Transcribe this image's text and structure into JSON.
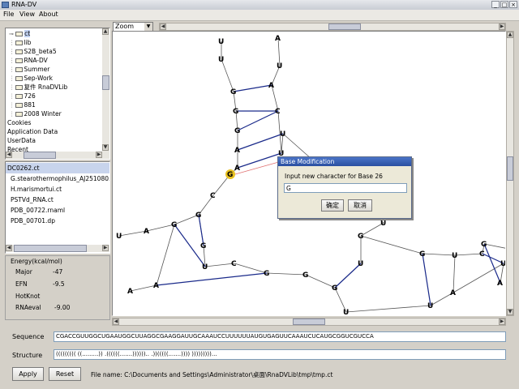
{
  "window": {
    "title": "RNA-DV",
    "minimize": "_",
    "maximize": "□",
    "close": "×"
  },
  "menu": [
    "File",
    "View",
    "About"
  ],
  "tree": {
    "items": [
      "ct",
      "lib",
      "S2B_beta5",
      "RNA-DV",
      "Summer",
      "Sep-Work",
      "复件 RnaDVLib",
      "726",
      "881",
      "2008 Winter",
      "Cookies",
      "Application Data",
      "UserData",
      "Recent"
    ]
  },
  "files": {
    "items": [
      "DC0262.ct",
      "G.stearothermophilus_AJ251080.ct",
      "H.marismortui.ct",
      "PSTVd_RNA.ct",
      "PDB_00722.rnaml",
      "PDB_00701.dp"
    ]
  },
  "energy": {
    "title": "Energy(kcal/mol)",
    "rows": [
      {
        "label": "Major",
        "value": "-47"
      },
      {
        "label": "EFN",
        "value": "-9.5"
      },
      {
        "label": "HotKnot",
        "value": ""
      },
      {
        "label": "RNAeval",
        "value": "-9.00"
      }
    ]
  },
  "toolbar": {
    "zoom_label": "Zoom"
  },
  "dialog": {
    "title": "Base Modification",
    "prompt": "Input new character for Base 26",
    "input_value": "G",
    "ok_label": "确定",
    "cancel_label": "取消"
  },
  "sequence": {
    "label": "Sequence",
    "value": "CGACCGUUGGCUGAAUGGCUUAGGCGAAGGAUUGCAAAUCCUUUUUUAUGUGAGUUCAAAUCUCAUGCGGUCGUCCA"
  },
  "structure": {
    "label": "Structure",
    "value": "((((((((( ((.........)) .((((((.......)))))).. .))(((((.......)))) )))))))))..."
  },
  "buttons": {
    "apply": "Apply",
    "reset": "Reset"
  },
  "status": {
    "file_name": "File name: C:\\Documents and Settings\\Administrator\\桌面\\RnaDVLib\\tmp\\tmp.ct"
  },
  "highlight_color": "#e8c020",
  "pair_color": "#1a2a8a"
}
